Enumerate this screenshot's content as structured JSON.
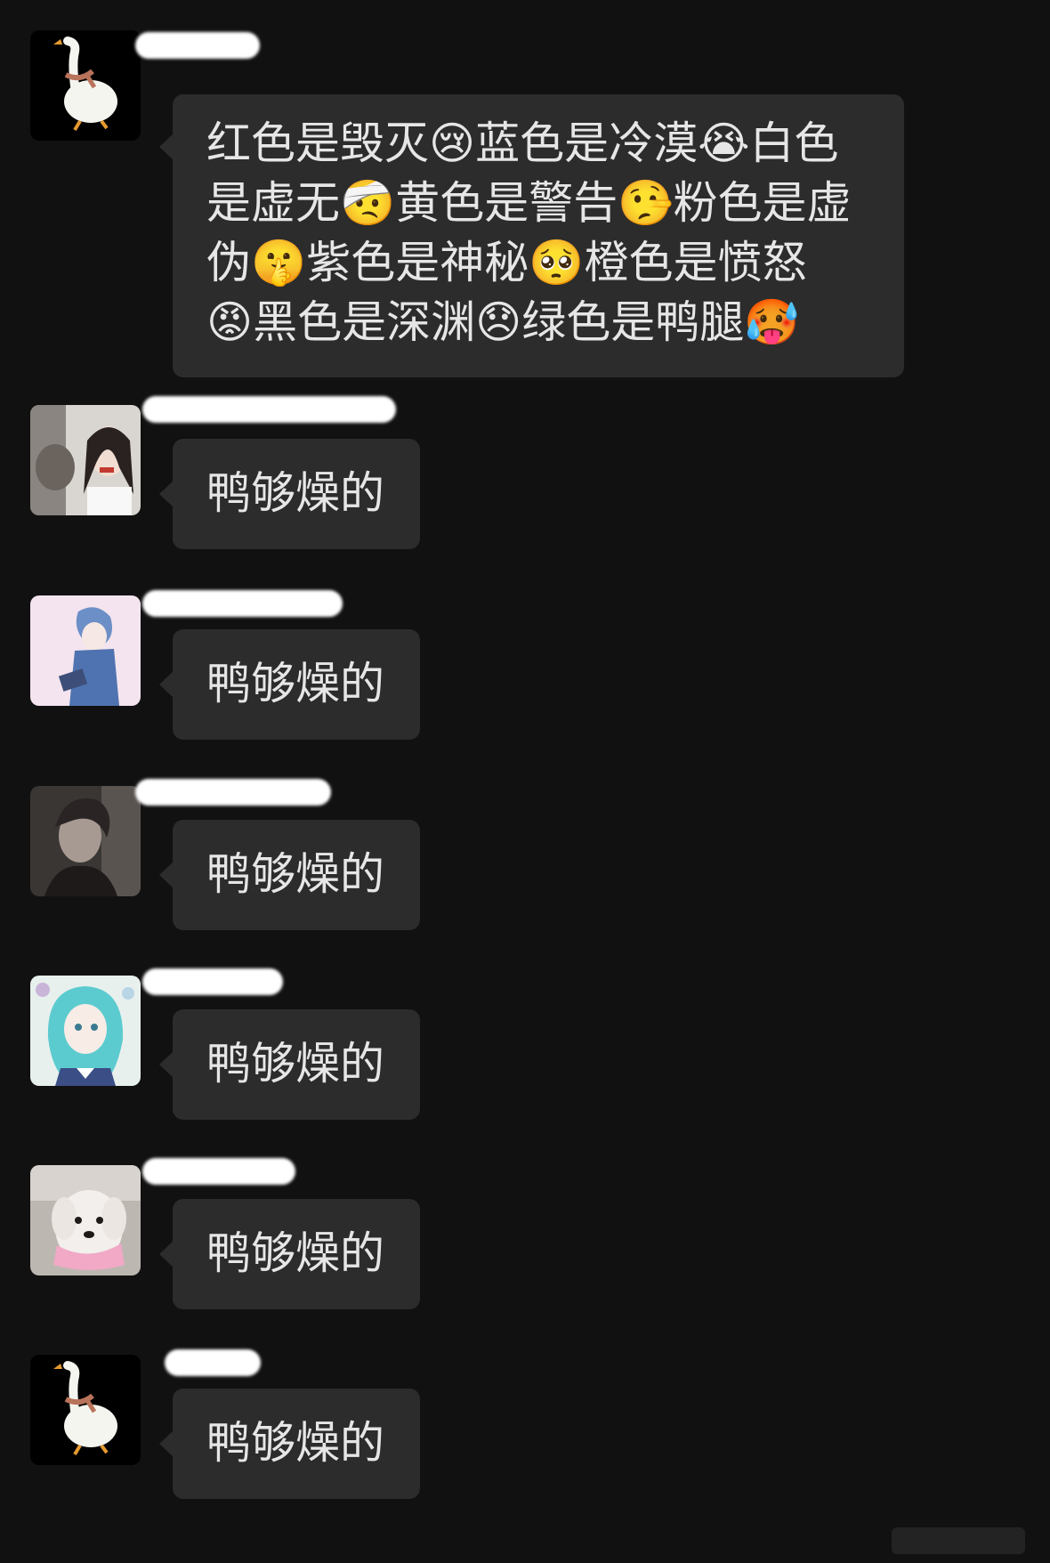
{
  "messages": [
    {
      "sender_avatar": "goose-avatar",
      "text_lines": [
        "红色是毁灭😢蓝色是冷漠😭白色",
        "是虚无🤕黄色是警告🤥粉色是虚",
        "伪🤫紫色是神秘🥺橙色是愤怒",
        "😡黑色是深渊😞绿色是鸭腿🥵"
      ]
    },
    {
      "sender_avatar": "girl-with-cat-avatar",
      "text": "鸭够燥的"
    },
    {
      "sender_avatar": "anime-boy-avatar",
      "text": "鸭够燥的"
    },
    {
      "sender_avatar": "dark-photo-avatar",
      "text": "鸭够燥的"
    },
    {
      "sender_avatar": "anime-girl-avatar",
      "text": "鸭够燥的"
    },
    {
      "sender_avatar": "white-dog-avatar",
      "text": "鸭够燥的"
    },
    {
      "sender_avatar": "goose-avatar",
      "text": "鸭够燥的"
    }
  ]
}
